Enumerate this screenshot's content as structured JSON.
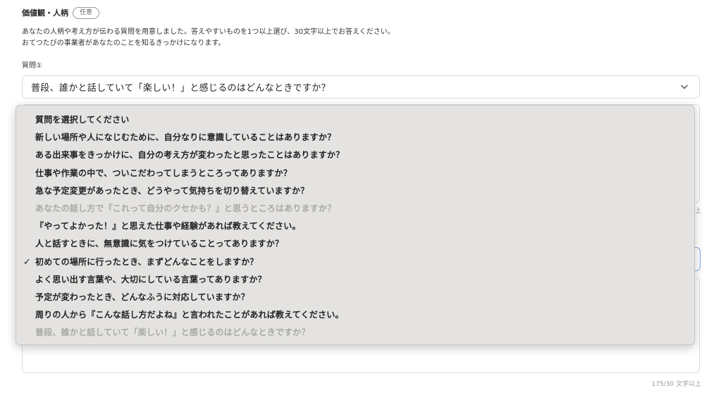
{
  "section": {
    "title": "価値観・人柄",
    "badge": "任意",
    "description_line1": "あなたの人柄や考え方が伝わる質問を用意しました。答えやすいものを1つ以上選び、30文字以上でお答えください。",
    "description_line2": "おてつたびの事業者があなたのことを知るきっかけになります。"
  },
  "question1": {
    "label": "質問①",
    "selected": "普段、誰かと話していて「楽しい！」と感じるのはどんなときですか？",
    "counter_fragment": "上"
  },
  "question2": {
    "counter": "175/30 文字以上"
  },
  "dropdown": {
    "checkmark": "✓",
    "options": [
      {
        "label": "質問を選択してください",
        "disabled": false,
        "checked": false
      },
      {
        "label": "新しい場所や人になじむために、自分なりに意識していることはありますか？",
        "disabled": false,
        "checked": false
      },
      {
        "label": "ある出来事をきっかけに、自分の考え方が変わったと思ったことはありますか？",
        "disabled": false,
        "checked": false
      },
      {
        "label": "仕事や作業の中で、ついこだわってしまうところってありますか？",
        "disabled": false,
        "checked": false
      },
      {
        "label": "急な予定変更があったとき、どうやって気持ちを切り替えていますか？",
        "disabled": false,
        "checked": false
      },
      {
        "label": "あなたの話し方で『これって自分のクセかも？』と思うところはありますか？",
        "disabled": true,
        "checked": false
      },
      {
        "label": "『やってよかった！』と思えた仕事や経験があれば教えてください。",
        "disabled": false,
        "checked": false
      },
      {
        "label": "人と話すときに、無意識に気をつけていることってありますか？",
        "disabled": false,
        "checked": false
      },
      {
        "label": "初めての場所に行ったとき、まずどんなことをしますか？",
        "disabled": false,
        "checked": true
      },
      {
        "label": "よく思い出す言葉や、大切にしている言葉ってありますか？",
        "disabled": false,
        "checked": false
      },
      {
        "label": "予定が変わったとき、どんなふうに対応していますか？",
        "disabled": false,
        "checked": false
      },
      {
        "label": "周りの人から『こんな話し方だよね』と言われたことがあれば教えてください。",
        "disabled": false,
        "checked": false
      },
      {
        "label": "普段、誰かと話していて「楽しい！」と感じるのはどんなときですか？",
        "disabled": true,
        "checked": false
      }
    ]
  },
  "colors": {
    "dropdown_bg": "#e4e3e1",
    "disabled_text": "#a9a8a6",
    "focus_border": "#7aa7e6"
  },
  "icons": {
    "select_chevron": "chevron-down-icon",
    "checked_option": "checkmark-icon"
  }
}
